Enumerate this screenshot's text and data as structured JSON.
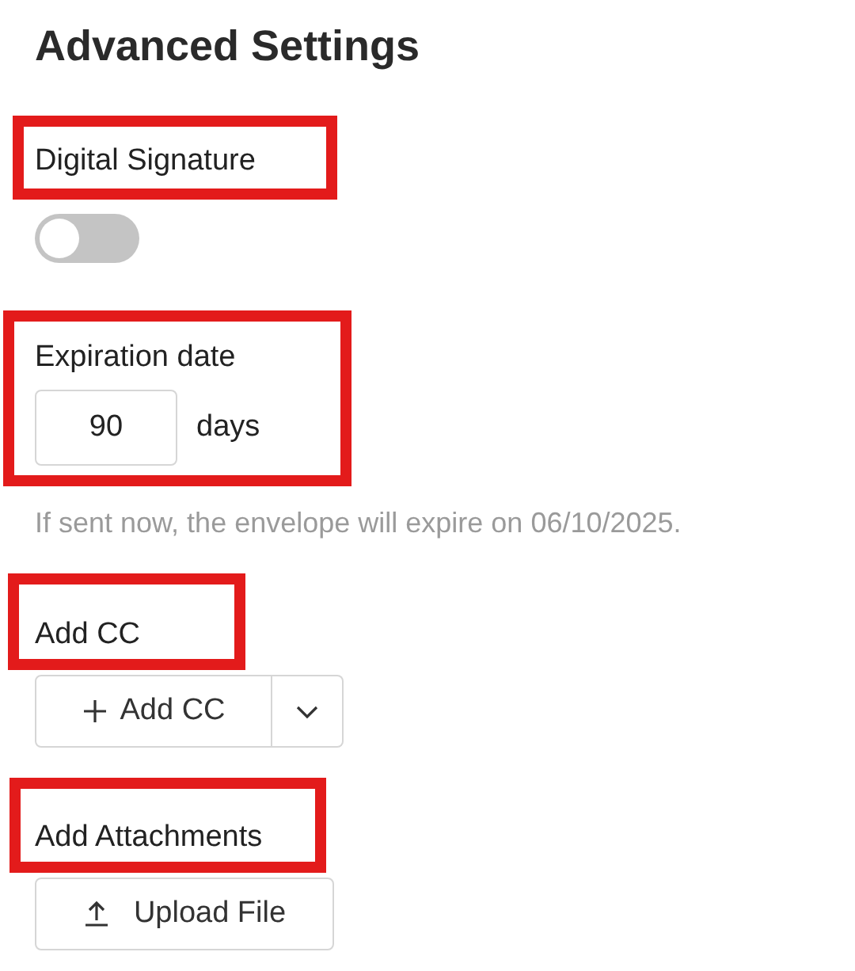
{
  "title": "Advanced Settings",
  "sections": [
    {
      "kind": "toggle",
      "label": "Digital Signature",
      "highlighted": true,
      "on": false
    },
    {
      "kind": "number",
      "label": "Expiration date",
      "highlighted": true,
      "value": "90",
      "unit": "days",
      "hint": "If sent now, the envelope will expire on 06/10/2025."
    },
    {
      "kind": "split-button",
      "label": "Add CC",
      "highlighted": true,
      "button": "Add CC"
    },
    {
      "kind": "upload",
      "label": "Add Attachments",
      "highlighted": true,
      "button": "Upload File"
    }
  ]
}
